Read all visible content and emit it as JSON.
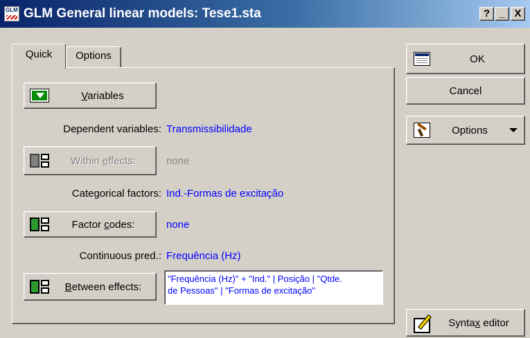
{
  "window": {
    "icon_text": "GLM",
    "title": "GLM General linear models: Tese1.sta",
    "help_button": "?",
    "minimize_button": "_",
    "close_button": "X"
  },
  "tabs": [
    {
      "label": "Quick",
      "active": true
    },
    {
      "label": "Options",
      "active": false
    }
  ],
  "quick": {
    "variables_button": {
      "pre": "",
      "key": "V",
      "post": "ariables"
    },
    "dependent": {
      "label": "Dependent variables:",
      "value": "Transmissibilidade"
    },
    "within_button": {
      "pre": "Within ",
      "key": "e",
      "post": "ffects:",
      "enabled": false
    },
    "within_value": "none",
    "categorical": {
      "label": "Categorical factors:",
      "value": "Ind.-Formas de excitação"
    },
    "factor_codes_button": {
      "pre": "Factor ",
      "key": "c",
      "post": "odes:"
    },
    "factor_codes_value": "none",
    "continuous": {
      "label": "Continuous pred.:",
      "value": "Frequência (Hz)"
    },
    "between_button": {
      "pre": "",
      "key": "B",
      "post": "etween effects:"
    },
    "between_value_line1": "\"Frequência (Hz)\" + \"Ind.\" | Posição | \"Qtde.",
    "between_value_line2": "de Pessoas\" | \"Formas de excitação\""
  },
  "side": {
    "ok": "OK",
    "cancel": "Cancel",
    "options": "Options",
    "syntax": {
      "pre": "Synta",
      "key": "x",
      "post": " editor"
    }
  },
  "icons": [
    "glm-app-icon",
    "variables-icon",
    "effects-icon",
    "ok-icon",
    "options-hammer-icon",
    "syntax-editor-icon",
    "chevron-down-icon"
  ]
}
